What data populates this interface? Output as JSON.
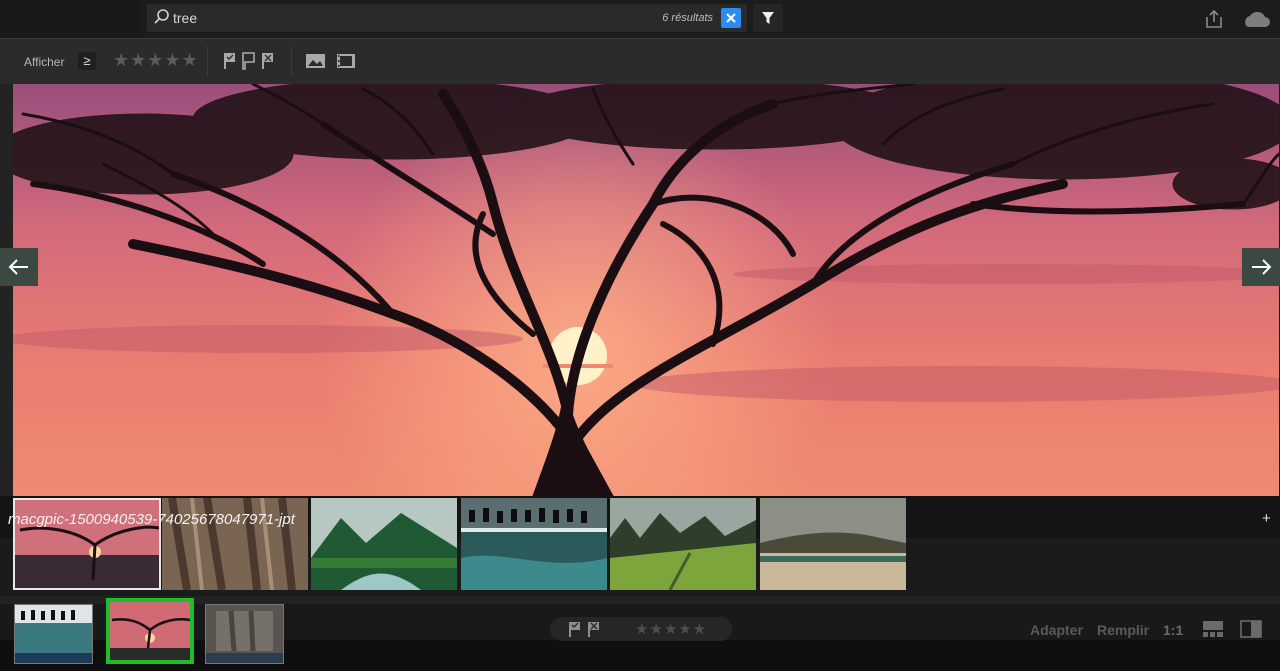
{
  "search": {
    "query": "tree",
    "results": "6 résultats"
  },
  "toolbar": {
    "show_label": "Afficher",
    "rating_operator": "≥",
    "stars": "★★★★★"
  },
  "photo": {
    "filename": "macgpic-1500940539-74025678047971-jpt"
  },
  "filmstrip": {
    "add_label": "+"
  },
  "bottombar": {
    "fit_label": "Adapter",
    "fill_label": "Remplir",
    "one_to_one_label": "1:1",
    "stars": "★★★★★"
  },
  "colors": {
    "accent": "#2a8cf0",
    "selection": "#1fbd2a",
    "nav_button": "#3a4a40"
  },
  "icons": [
    "search-icon",
    "clear-icon",
    "filter-icon",
    "share-icon",
    "cloud-icon",
    "flag-pick-icon",
    "flag-unflagged-icon",
    "flag-reject-icon",
    "photo-icon",
    "video-icon",
    "arrow-left-icon",
    "arrow-right-icon",
    "plus-icon",
    "grid-icon",
    "compare-icon"
  ]
}
